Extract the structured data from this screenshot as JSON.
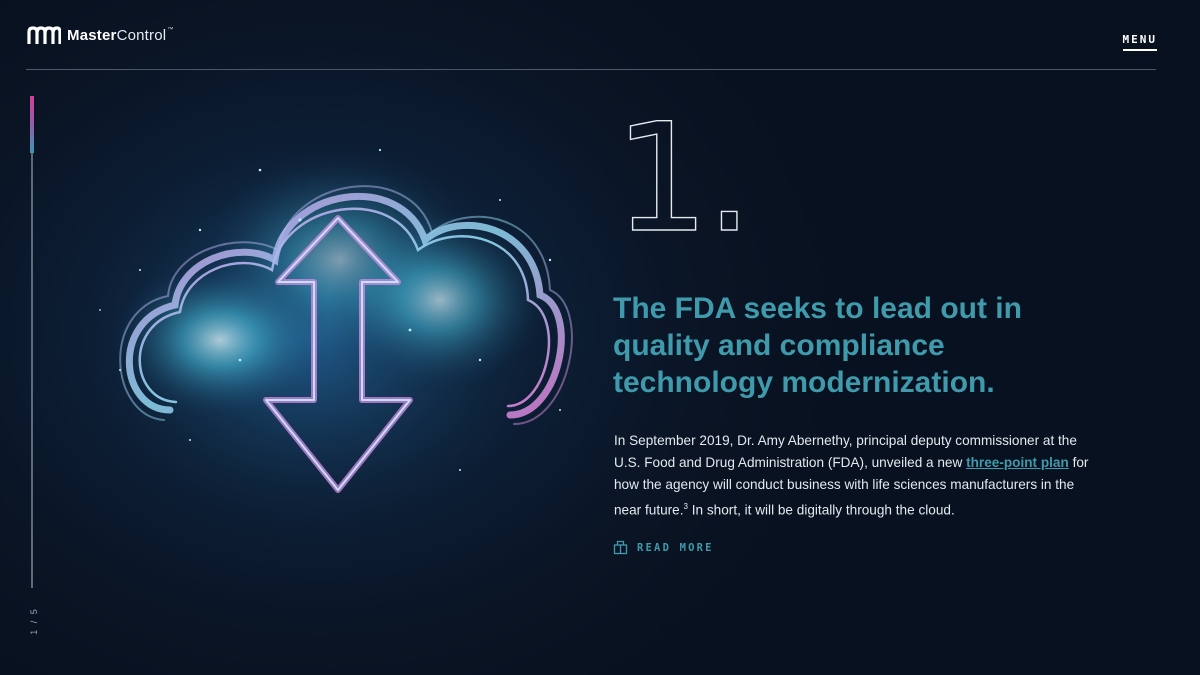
{
  "brand": {
    "name_bold": "Master",
    "name_light": "Control",
    "trademark": "™",
    "logo_icon": "mastercontrol-logo-icon"
  },
  "header": {
    "menu_label": "MENU"
  },
  "progress": {
    "label": "1 / 5",
    "current": 1,
    "total": 5
  },
  "slide": {
    "number": "1.",
    "headline": "The FDA seeks to lead out in quality and compliance technology modernization.",
    "body_before_link": "In September 2019, Dr. Amy Abernethy, principal deputy commissioner at the U.S. Food and Drug Administration (FDA), unveiled a new ",
    "body_link": "three-point plan",
    "body_after_link": " for how the agency will conduct business with life sciences manufacturers in the near future.",
    "footnote": "3",
    "body_end": " In short, it will be digitally through the cloud.",
    "read_more_label": "READ MORE",
    "read_more_icon": "book-icon",
    "illustration": "cloud-upload-download-illustration"
  },
  "colors": {
    "background": "#0a1424",
    "accent": "#3f9aab",
    "progress_top": "#d43f9a",
    "progress_bottom": "#3c96ad",
    "text": "#e3e9ef"
  }
}
